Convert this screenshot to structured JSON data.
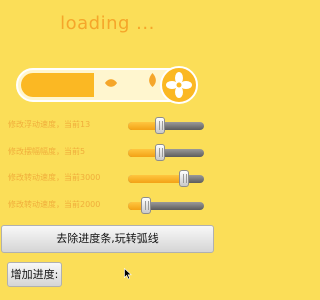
{
  "header": {
    "title": "loading ..."
  },
  "progress": {
    "value": 0.52
  },
  "sliders": [
    {
      "label": "修改浮动速度，当前13",
      "value": 0.42
    },
    {
      "label": "修改摆幅幅度，当前5",
      "value": 0.42
    },
    {
      "label": "修改转动速度，当前3000",
      "value": 0.74
    },
    {
      "label": "修改转动速度，当前2000",
      "value": 0.24
    }
  ],
  "buttons": {
    "remove_label": "去除进度条,玩转弧线",
    "add_label": "增加进度:"
  },
  "icons": {
    "leaf": "leaf-icon",
    "fan": "fan-icon",
    "cursor": "mouse-cursor-icon"
  },
  "colors": {
    "background": "#fbde58",
    "accent": "#fbb823",
    "title": "#f5a62a"
  }
}
